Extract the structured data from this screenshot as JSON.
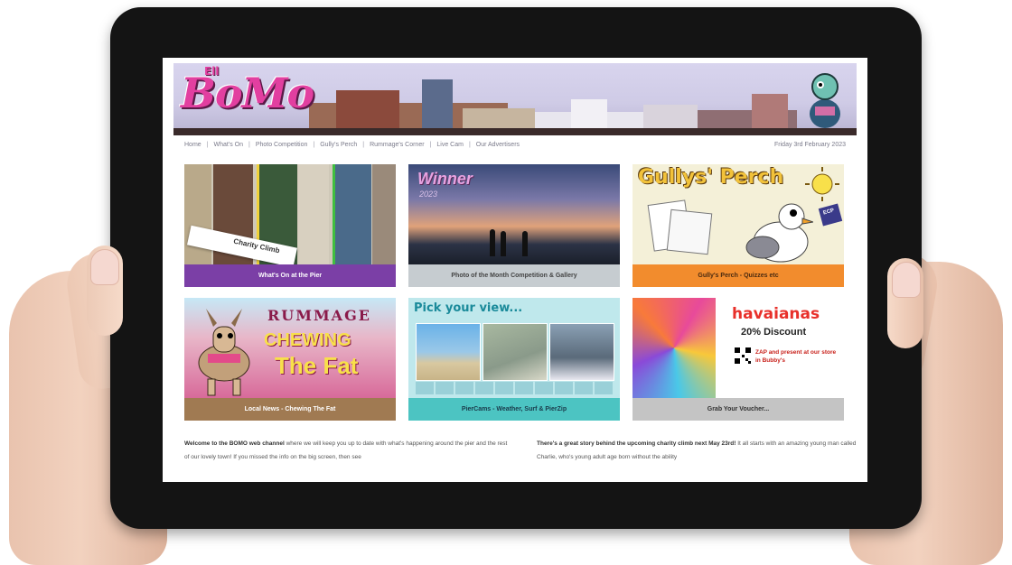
{
  "site": {
    "logo_small": "Ell",
    "logo": "BoMo",
    "nav": [
      "Home",
      "What's On",
      "Photo Competition",
      "Gully's Perch",
      "Rummage's Corner",
      "Live Cam",
      "Our Advertisers"
    ],
    "date": "Friday 3rd February 2023"
  },
  "tiles": [
    {
      "caption": "What's On at the Pier",
      "caption_color": "#7b3fa6",
      "label": "Charity Climb"
    },
    {
      "caption": "Photo of the Month Competition & Gallery",
      "caption_color": "#c6ccd0",
      "overlay_title": "Winner",
      "overlay_sub": "2023"
    },
    {
      "caption": "Gully's Perch - Quizzes etc",
      "caption_color": "#f28c2d",
      "title": "Gullys' Perch",
      "badge": "ECP"
    },
    {
      "caption": "Local News - Chewing The Fat",
      "caption_color": "#a07a52",
      "line1": "RUMMAGE",
      "line2": "CHEWING",
      "line3": "The Fat"
    },
    {
      "caption": "PierCams - Weather, Surf & PierZip",
      "caption_color": "#4cc4c2",
      "title": "Pick your view..."
    },
    {
      "caption": "Grab Your Voucher...",
      "caption_color": "#c4c4c4",
      "brand": "havaianas",
      "discount": "20% Discount",
      "promo": "ZAP and present at our store in Bubby's"
    }
  ],
  "intro": {
    "left_bold": "Welcome to the BOMO web channel",
    "left_rest": " where we will keep you up to date with what's happening around the pier and the rest of our lovely town! If you missed the info on the big screen, then see",
    "right_bold": "There's a great story behind the upcoming charity climb next May 23rd!",
    "right_rest": " It all starts with an amazing young man called Charlie, who's young adult age born without the ability"
  }
}
